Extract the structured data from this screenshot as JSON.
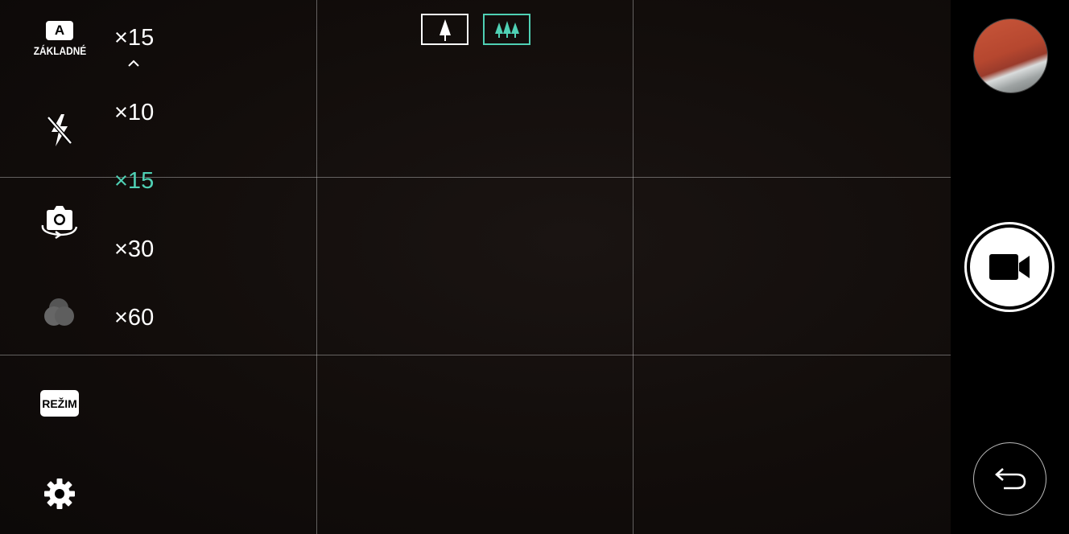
{
  "camera_mode": {
    "auto_badge": "A",
    "label": "ZÁKLADNÉ"
  },
  "mode_button_label": "REŽIM",
  "timelapse": {
    "options": [
      "×15",
      "×10",
      "×15",
      "×30",
      "×60"
    ],
    "current_value": "×15",
    "selected_index": 2
  },
  "view_toggle": {
    "options": [
      "single-tree-icon",
      "multi-tree-icon"
    ],
    "active": "multi-tree-icon"
  },
  "icons": {
    "flash": "flash-off-icon",
    "switch_camera": "switch-camera-icon",
    "filter": "color-filter-icon",
    "settings": "gear-icon",
    "record": "video-camera-icon",
    "back": "back-arrow-icon",
    "expand": "chevron-up-icon"
  },
  "colors": {
    "accent": "#4fd0b4",
    "foreground": "#ffffff",
    "background": "#000000"
  }
}
